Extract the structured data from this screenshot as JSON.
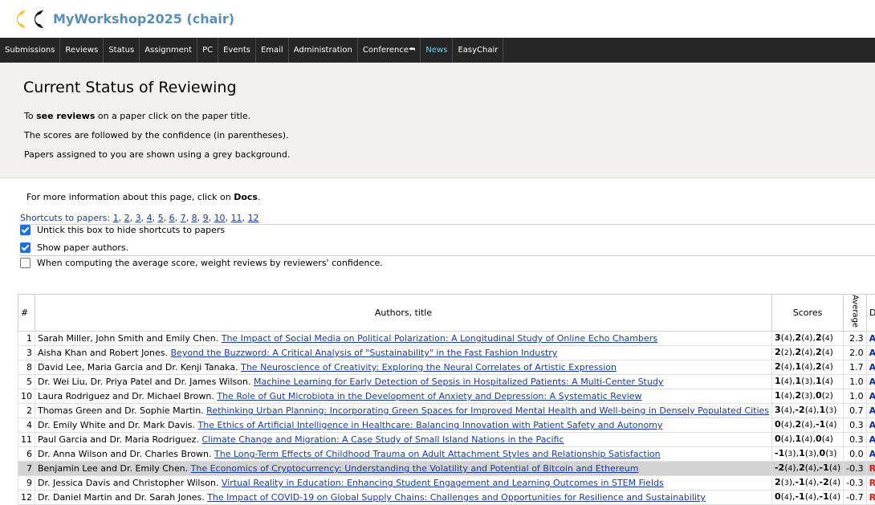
{
  "app": {
    "title": "MyWorkshop2025 (chair)"
  },
  "menu": [
    {
      "label": "Submissions"
    },
    {
      "label": "Reviews"
    },
    {
      "label": "Status"
    },
    {
      "label": "Assignment"
    },
    {
      "label": "PC"
    },
    {
      "label": "Events"
    },
    {
      "label": "Email"
    },
    {
      "label": "Administration"
    },
    {
      "label": "Conference",
      "glyph": "⮪"
    },
    {
      "label": "News",
      "active": true
    },
    {
      "label": "EasyChair"
    }
  ],
  "page": {
    "title": "Current Status of Reviewing",
    "info1_prefix": "To ",
    "info1_bold": "see reviews",
    "info1_suffix": " on a paper click on the paper title.",
    "info2": "The scores are followed by the confidence (in parentheses).",
    "info3": "Papers assigned to you are shown using a grey background.",
    "docs_prefix": "For more information about this page, click on ",
    "docs_link": "Docs",
    "docs_suffix": "."
  },
  "shortcuts": {
    "label": "Shortcuts to papers:",
    "links": [
      "1",
      "2",
      "3",
      "4",
      "5",
      "6",
      "7",
      "8",
      "9",
      "10",
      "11",
      "12"
    ]
  },
  "options": {
    "hide_shortcuts": "Untick this box to hide shortcuts to papers",
    "show_authors": "Show paper authors.",
    "weight_reviews": "When computing the average score, weight reviews by reviewers' confidence."
  },
  "table": {
    "headers": {
      "num": "#",
      "title": "Authors, title",
      "scores": "Scores",
      "average": "Average",
      "decision": "Decision"
    },
    "rows": [
      {
        "num": "1",
        "authors": "Sarah Miller, John Smith and Emily Chen.",
        "title": "The Impact of Social Media on Political Polarization: A Longitudinal Study of Online Echo Chambers",
        "scores": [
          [
            "3",
            "4"
          ],
          [
            "2",
            "4"
          ],
          [
            "2",
            "4"
          ]
        ],
        "avg": "2.3",
        "decision": "ACCEPT"
      },
      {
        "num": "3",
        "authors": "Aisha Khan and Robert Jones.",
        "title": "Beyond the Buzzword: A Critical Analysis of \"Sustainability\" in the Fast Fashion Industry",
        "scores": [
          [
            "2",
            "2"
          ],
          [
            "2",
            "4"
          ],
          [
            "2",
            "4"
          ]
        ],
        "avg": "2.0",
        "decision": "ACCEPT"
      },
      {
        "num": "8",
        "authors": "David Lee, Maria Garcia and Dr. Kenji Tanaka.",
        "title": "The Neuroscience of Creativity: Exploring the Neural Correlates of Artistic Expression",
        "scores": [
          [
            "2",
            "4"
          ],
          [
            "1",
            "4"
          ],
          [
            "2",
            "4"
          ]
        ],
        "avg": "1.7",
        "decision": "ACCEPT"
      },
      {
        "num": "5",
        "authors": "Dr. Wei Liu, Dr. Priya Patel and Dr. James Wilson.",
        "title": "Machine Learning for Early Detection of Sepsis in Hospitalized Patients: A Multi-Center Study",
        "scores": [
          [
            "1",
            "4"
          ],
          [
            "1",
            "3"
          ],
          [
            "1",
            "4"
          ]
        ],
        "avg": "1.0",
        "decision": "ACCEPT"
      },
      {
        "num": "10",
        "authors": "Laura Rodriguez and Dr. Michael Brown.",
        "title": "The Role of Gut Microbiota in the Development of Anxiety and Depression: A Systematic Review",
        "scores": [
          [
            "1",
            "4"
          ],
          [
            "2",
            "3"
          ],
          [
            "0",
            "2"
          ]
        ],
        "avg": "1.0",
        "decision": "ACCEPT"
      },
      {
        "num": "2",
        "authors": "Thomas Green and Dr. Sophie Martin.",
        "title": "Rethinking Urban Planning: Incorporating Green Spaces for Improved Mental Health and Well-being in Densely Populated Cities",
        "scores": [
          [
            "3",
            "4"
          ],
          [
            "-2",
            "4"
          ],
          [
            "1",
            "3"
          ]
        ],
        "avg": "0.7",
        "decision": "ACCEPT"
      },
      {
        "num": "4",
        "authors": "Dr. Emily White and Dr. Mark Davis.",
        "title": "The Ethics of Artificial Intelligence in Healthcare: Balancing Innovation with Patient Safety and Autonomy",
        "scores": [
          [
            "0",
            "4"
          ],
          [
            "2",
            "4"
          ],
          [
            "-1",
            "4"
          ]
        ],
        "avg": "0.3",
        "decision": "ACCEPT"
      },
      {
        "num": "11",
        "authors": "Paul Garcia and Dr. Maria Rodriguez.",
        "title": "Climate Change and Migration: A Case Study of Small Island Nations in the Pacific",
        "scores": [
          [
            "0",
            "4"
          ],
          [
            "1",
            "4"
          ],
          [
            "0",
            "4"
          ]
        ],
        "avg": "0.3",
        "decision": "ACCEPT"
      },
      {
        "num": "6",
        "authors": "Dr. Anna Wilson and Dr. Charles Brown.",
        "title": "The Long-Term Effects of Childhood Trauma on Adult Attachment Styles and Relationship Satisfaction",
        "scores": [
          [
            "-1",
            "3"
          ],
          [
            "1",
            "3"
          ],
          [
            "0",
            "3"
          ]
        ],
        "avg": "0.0",
        "decision": "ACCEPT"
      },
      {
        "num": "7",
        "authors": "Benjamin Lee and Dr. Emily Chen.",
        "title": "The Economics of Cryptocurrency: Understanding the Volatility and Potential of Bitcoin and Ethereum",
        "scores": [
          [
            "-2",
            "4"
          ],
          [
            "2",
            "4"
          ],
          [
            "-1",
            "4"
          ]
        ],
        "avg": "-0.3",
        "decision": "REJECT",
        "grey": true
      },
      {
        "num": "9",
        "authors": "Dr. Jessica Davis and Christopher Wilson.",
        "title": "Virtual Reality in Education: Enhancing Student Engagement and Learning Outcomes in STEM Fields",
        "scores": [
          [
            "2",
            "3"
          ],
          [
            "-1",
            "4"
          ],
          [
            "-2",
            "4"
          ]
        ],
        "avg": "-0.3",
        "decision": "REJECT"
      },
      {
        "num": "12",
        "authors": "Dr. Daniel Martin and Dr. Sarah Jones.",
        "title": "The Impact of COVID-19 on Global Supply Chains: Challenges and Opportunities for Resilience and Sustainability",
        "scores": [
          [
            "0",
            "4"
          ],
          [
            "-1",
            "4"
          ],
          [
            "-1",
            "4"
          ]
        ],
        "avg": "-0.7",
        "decision": "REJECT"
      }
    ]
  },
  "colors": {
    "menubar": "#262626",
    "active_menu": "#6ad3ea",
    "accept": "#0a2f9a",
    "reject": "#e31414",
    "title": "#5a8fb5",
    "assigned_row": "#d3d3d3"
  }
}
